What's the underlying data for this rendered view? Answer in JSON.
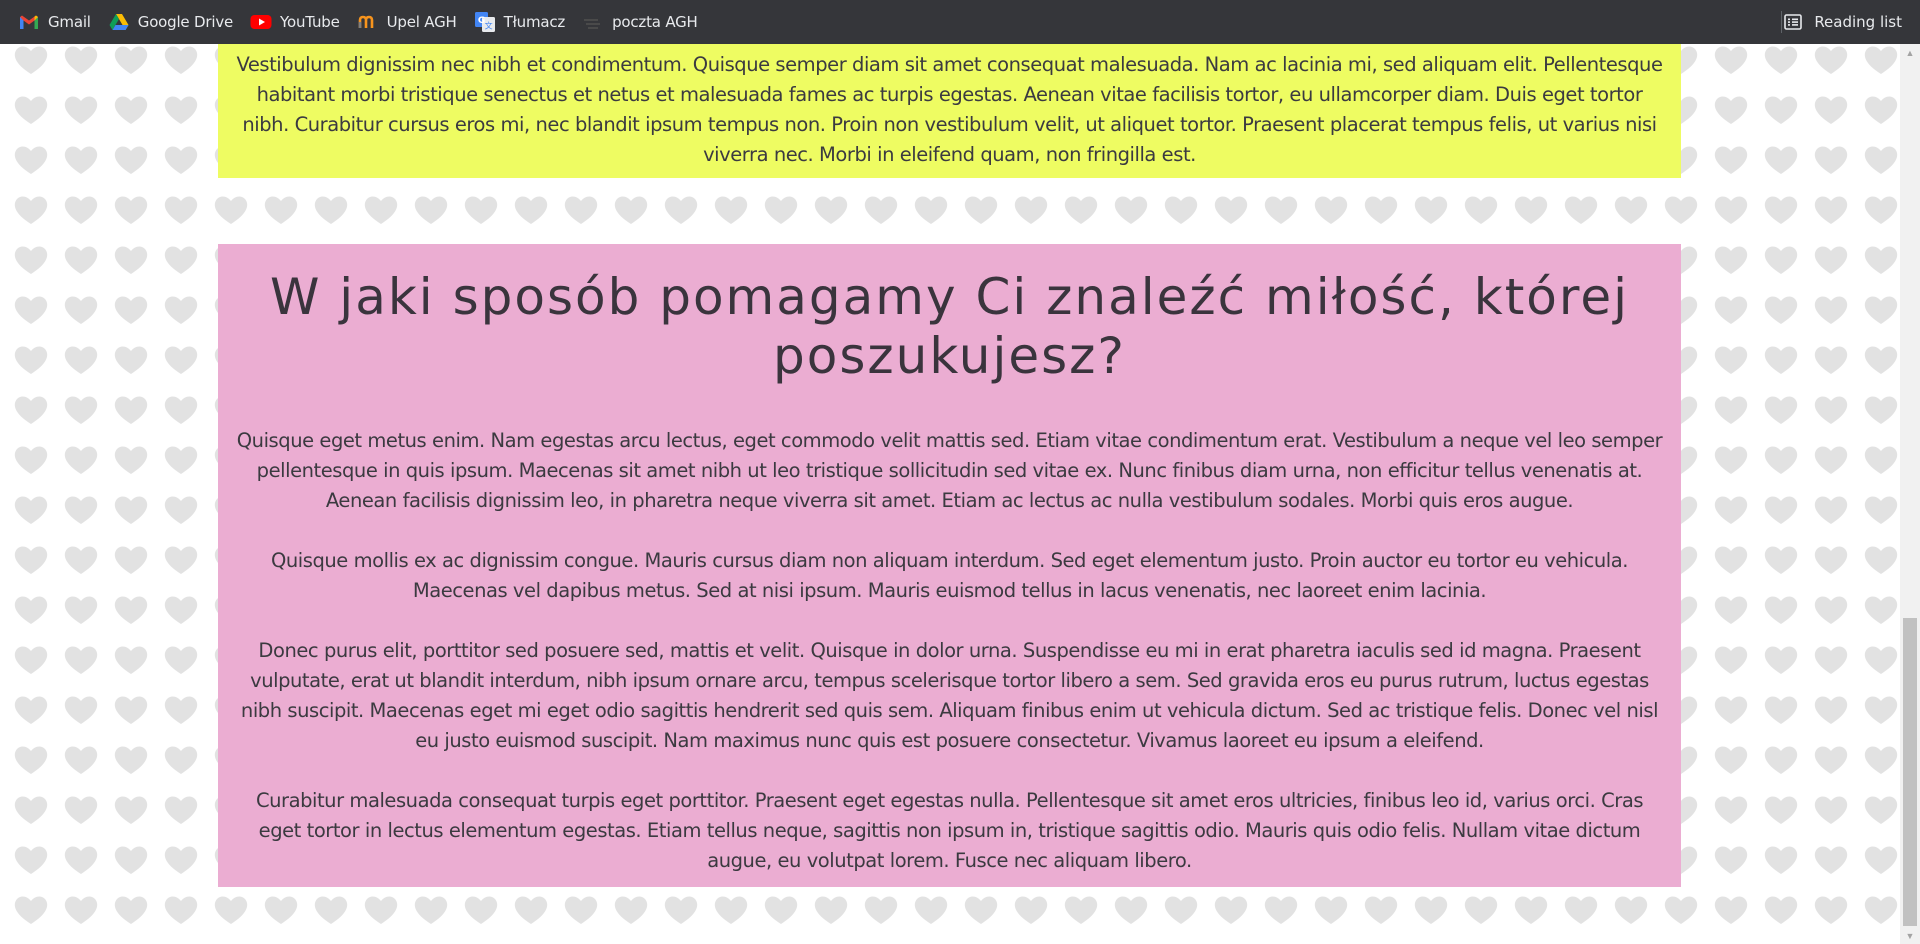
{
  "bookmarks": [
    {
      "label": "Gmail",
      "icon": "gmail-icon"
    },
    {
      "label": "Google Drive",
      "icon": "google-drive-icon"
    },
    {
      "label": "YouTube",
      "icon": "youtube-icon"
    },
    {
      "label": "Upel AGH",
      "icon": "upel-icon"
    },
    {
      "label": "Tłumacz",
      "icon": "translate-icon"
    },
    {
      "label": "poczta AGH",
      "icon": "mail-icon"
    }
  ],
  "reading_list": {
    "label": "Reading list",
    "icon": "reading-list-icon"
  },
  "colors": {
    "yellow_box": "#eefc62",
    "pink_box": "#ebadd2",
    "toolbar": "#35363a"
  },
  "yellow_section": {
    "text": "Vestibulum dignissim nec nibh et condimentum. Quisque semper diam sit amet consequat malesuada. Nam ac lacinia mi, sed aliquam elit. Pellentesque habitant morbi tristique senectus et netus et malesuada fames ac turpis egestas. Aenean vitae facilisis tortor, eu ullamcorper diam. Duis eget tortor nibh. Curabitur cursus eros mi, nec blandit ipsum tempus non. Proin non vestibulum velit, ut aliquet tortor. Praesent placerat tempus felis, ut varius nisi viverra nec. Morbi in eleifend quam, non fringilla est."
  },
  "pink_section": {
    "heading": "W jaki sposób pomagamy Ci znaleźć miłość, której poszukujesz?",
    "paragraphs": [
      "Quisque eget metus enim. Nam egestas arcu lectus, eget commodo velit mattis sed. Etiam vitae condimentum erat. Vestibulum a neque vel leo semper pellentesque in quis ipsum. Maecenas sit amet nibh ut leo tristique sollicitudin sed vitae ex. Nunc finibus diam urna, non efficitur tellus venenatis at. Aenean facilisis dignissim leo, in pharetra neque viverra sit amet. Etiam ac lectus ac nulla vestibulum sodales. Morbi quis eros augue.",
      "Quisque mollis ex ac dignissim congue. Mauris cursus diam non aliquam interdum. Sed eget elementum justo. Proin auctor eu tortor eu vehicula. Maecenas vel dapibus metus. Sed at nisi ipsum. Mauris euismod tellus in lacus venenatis, nec laoreet enim lacinia.",
      "Donec purus elit, porttitor sed posuere sed, mattis et velit. Quisque in dolor urna. Suspendisse eu mi in erat pharetra iaculis sed id magna. Praesent vulputate, erat ut blandit interdum, nibh ipsum ornare arcu, tempus scelerisque tortor libero a sem. Sed gravida eros eu purus rutrum, luctus egestas nibh suscipit. Maecenas eget mi eget odio sagittis hendrerit sed quis sem. Aliquam finibus enim ut vehicula dictum. Sed ac tristique felis. Donec vel nisl eu justo euismod suscipit. Nam maximus nunc quis est posuere consectetur. Vivamus laoreet eu ipsum a eleifend.",
      "Curabitur malesuada consequat turpis eget porttitor. Praesent eget egestas nulla. Pellentesque sit amet eros ultricies, finibus leo id, varius orci. Cras eget tortor in lectus elementum egestas. Etiam tellus neque, sagittis non ipsum in, tristique sagittis odio. Mauris quis odio felis. Nullam vitae dictum augue, eu volutpat lorem. Fusce nec aliquam libero."
    ]
  }
}
